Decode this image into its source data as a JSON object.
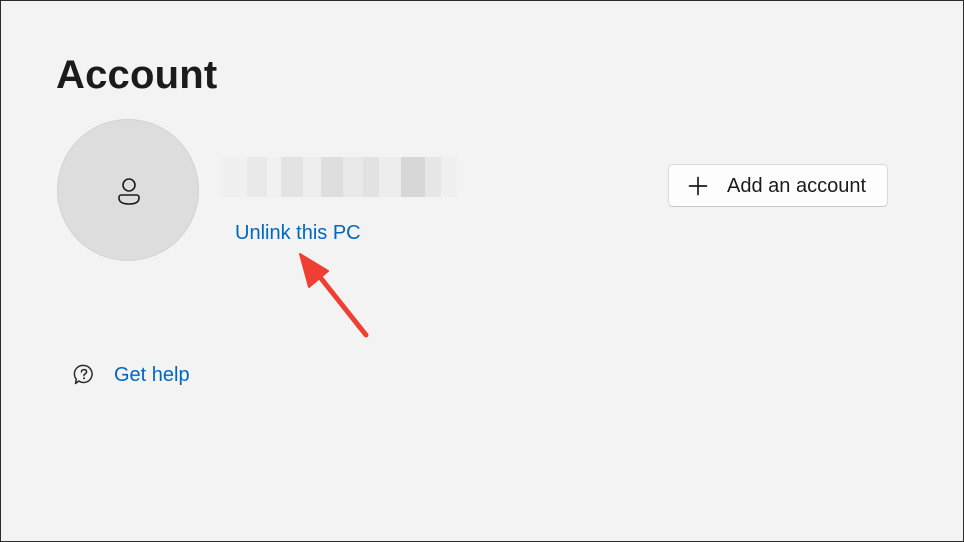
{
  "page": {
    "title": "Account"
  },
  "profile": {
    "avatar_icon": "person-icon",
    "unlink_label": "Unlink this PC"
  },
  "actions": {
    "add_account_icon": "plus-icon",
    "add_account_label": "Add an account"
  },
  "help": {
    "icon": "help-chat-icon",
    "label": "Get help"
  },
  "annotation": {
    "arrow_color": "#f03e32"
  },
  "colors": {
    "background": "#f3f3f3",
    "link": "#0067c0",
    "text": "#1b1b1b"
  }
}
